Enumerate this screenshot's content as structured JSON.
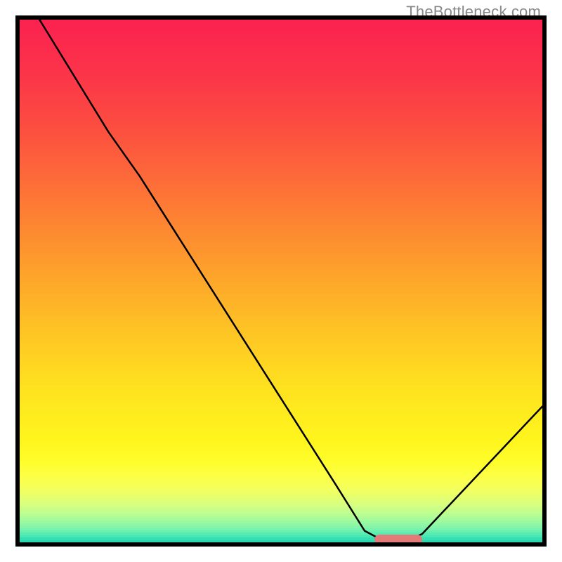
{
  "watermark": "TheBottleneck.com",
  "chart_data": {
    "type": "line",
    "title": "",
    "xlabel": "",
    "ylabel": "",
    "x_range": [
      0,
      100
    ],
    "y_range": [
      0,
      100
    ],
    "grid": false,
    "series": [
      {
        "name": "curve",
        "x": [
          3.8,
          17.0,
          23.0,
          60.5,
          66.0,
          69.6,
          71.5,
          73.5,
          77.0,
          100.0
        ],
        "y": [
          100.0,
          78.5,
          70.0,
          11.0,
          2.2,
          0.3,
          0.0,
          0.0,
          1.6,
          26.0
        ]
      }
    ],
    "marker": {
      "x_start": 67.9,
      "x_end": 77.0,
      "y": 0.6
    },
    "gradient_stops": [
      {
        "pos": 0.0,
        "color": "#fb2250"
      },
      {
        "pos": 0.1,
        "color": "#fc3449"
      },
      {
        "pos": 0.2,
        "color": "#fc4d41"
      },
      {
        "pos": 0.3,
        "color": "#fd6a39"
      },
      {
        "pos": 0.4,
        "color": "#fd8931"
      },
      {
        "pos": 0.5,
        "color": "#fda82a"
      },
      {
        "pos": 0.6,
        "color": "#fec624"
      },
      {
        "pos": 0.7,
        "color": "#fee11f"
      },
      {
        "pos": 0.8,
        "color": "#fff51e"
      },
      {
        "pos": 0.845,
        "color": "#fffd2b"
      },
      {
        "pos": 0.875,
        "color": "#fcff49"
      },
      {
        "pos": 0.9,
        "color": "#f0ff62"
      },
      {
        "pos": 0.92,
        "color": "#ddff79"
      },
      {
        "pos": 0.94,
        "color": "#c2fe8d"
      },
      {
        "pos": 0.955,
        "color": "#a4fb9d"
      },
      {
        "pos": 0.968,
        "color": "#85f6a9"
      },
      {
        "pos": 0.978,
        "color": "#66efb1"
      },
      {
        "pos": 0.986,
        "color": "#48e7b4"
      },
      {
        "pos": 0.993,
        "color": "#2edcb3"
      },
      {
        "pos": 1.0,
        "color": "#1acdab"
      }
    ]
  }
}
